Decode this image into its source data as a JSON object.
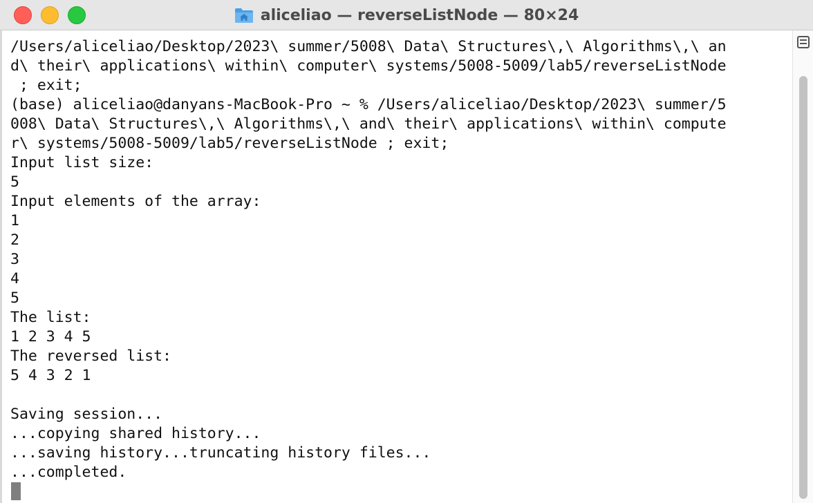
{
  "window": {
    "title": "aliceliao — reverseListNode — 80×24"
  },
  "icons": {
    "title": "home-folder-icon",
    "split": "split-pane-icon"
  },
  "colors": {
    "close": "#ff5f57",
    "minimize": "#febc2e",
    "zoom": "#28c840",
    "folder": "#4a9fe4"
  },
  "terminal": {
    "lines": [
      "/Users/aliceliao/Desktop/2023\\ summer/5008\\ Data\\ Structures\\,\\ Algorithms\\,\\ an",
      "d\\ their\\ applications\\ within\\ computer\\ systems/5008-5009/lab5/reverseListNode",
      " ; exit;",
      "(base) aliceliao@danyans-MacBook-Pro ~ % /Users/aliceliao/Desktop/2023\\ summer/5",
      "008\\ Data\\ Structures\\,\\ Algorithms\\,\\ and\\ their\\ applications\\ within\\ compute",
      "r\\ systems/5008-5009/lab5/reverseListNode ; exit;",
      "Input list size:",
      "5",
      "Input elements of the array:",
      "1",
      "2",
      "3",
      "4",
      "5",
      "The list:",
      "1 2 3 4 5",
      "The reversed list:",
      "5 4 3 2 1",
      "",
      "Saving session...",
      "...copying shared history...",
      "...saving history...truncating history files...",
      "...completed."
    ]
  }
}
